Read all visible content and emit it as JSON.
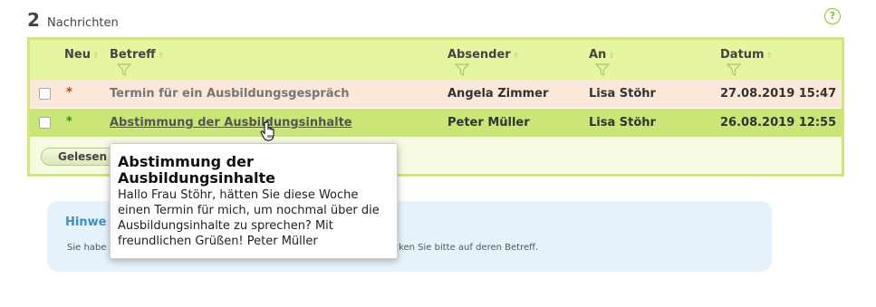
{
  "header": {
    "count": "2",
    "label": "Nachrichten",
    "help_glyph": "?"
  },
  "columns": {
    "new": "Neu",
    "subject": "Betreff",
    "sender": "Absender",
    "to": "An",
    "date": "Datum"
  },
  "messages": [
    {
      "marker": "*",
      "subject": "Termin für ein Ausbildungsgespräch",
      "sender": "Angela Zimmer",
      "to": "Lisa Stöhr",
      "date": "27.08.2019 15:47",
      "marker_color": "#e0301e"
    },
    {
      "marker": "*",
      "subject": "Abstimmung der Ausbildungsinhalte",
      "sender": "Peter Müller",
      "to": "Lisa Stöhr",
      "date": "26.08.2019 12:55",
      "marker_color": "#3a8a1e"
    }
  ],
  "actions": {
    "mark_read_label": "Gelesen"
  },
  "hint": {
    "title": "Hinwe",
    "text_start": "Sie habe",
    "text_end": "achricht klicken Sie bitte auf deren Betreff."
  },
  "tooltip": {
    "title": "Abstimmung der Ausbildungsinhalte",
    "body": "Hallo Frau Stöhr, hätten Sie diese Woche einen Termin für mich, um nochmal über die Ausbildungsinhalte zu sprechen? Mit freundlichen Grüßen! Peter Müller"
  },
  "colors": {
    "accent_green": "#8bbf1f",
    "hint_title": "#3c8fc0",
    "table_border": "#cfe67a"
  }
}
